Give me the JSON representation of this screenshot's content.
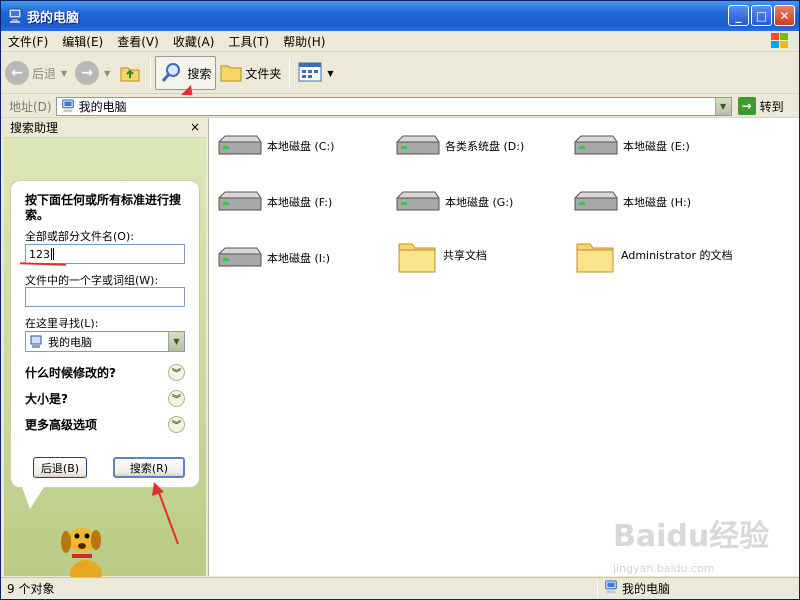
{
  "window": {
    "title": "我的电脑"
  },
  "menu": [
    "文件(F)",
    "编辑(E)",
    "查看(V)",
    "收藏(A)",
    "工具(T)",
    "帮助(H)"
  ],
  "toolbar": {
    "back": "后退",
    "search": "搜索",
    "folders": "文件夹"
  },
  "address": {
    "label": "地址(D)",
    "value": "我的电脑",
    "go": "转到"
  },
  "search_pane": {
    "header": "搜索助理",
    "close": "×",
    "title": "按下面任何或所有标准进行搜索。",
    "filename_label": "全部或部分文件名(O):",
    "filename_value": "123",
    "phrase_label": "文件中的一个字或词组(W):",
    "phrase_value": "",
    "lookin_label": "在这里寻找(L):",
    "lookin_value": "我的电脑",
    "options": [
      "什么时候修改的?",
      "大小是?",
      "更多高级选项"
    ],
    "back_button": "后退(B)",
    "search_button": "搜索(R)"
  },
  "items": [
    {
      "label": "本地磁盘 (C:)",
      "icon": "drive-icon"
    },
    {
      "label": "各类系统盘 (D:)",
      "icon": "drive-icon"
    },
    {
      "label": "本地磁盘 (E:)",
      "icon": "drive-icon"
    },
    {
      "label": "本地磁盘 (F:)",
      "icon": "drive-icon"
    },
    {
      "label": "本地磁盘 (G:)",
      "icon": "drive-icon"
    },
    {
      "label": "本地磁盘 (H:)",
      "icon": "drive-icon"
    },
    {
      "label": "本地磁盘 (I:)",
      "icon": "drive-icon"
    },
    {
      "label": "共享文档",
      "icon": "folder-icon"
    },
    {
      "label": "Administrator 的文档",
      "icon": "folder-icon"
    }
  ],
  "status": {
    "count": "9 个对象",
    "location": "我的电脑"
  },
  "watermark": {
    "text": "Baidu经验",
    "sub": "jingyan.baidu.com"
  },
  "colors": {
    "titlebar": "#1E66D8",
    "accent_red": "#E03030",
    "pane_green": "#C9D79C"
  }
}
